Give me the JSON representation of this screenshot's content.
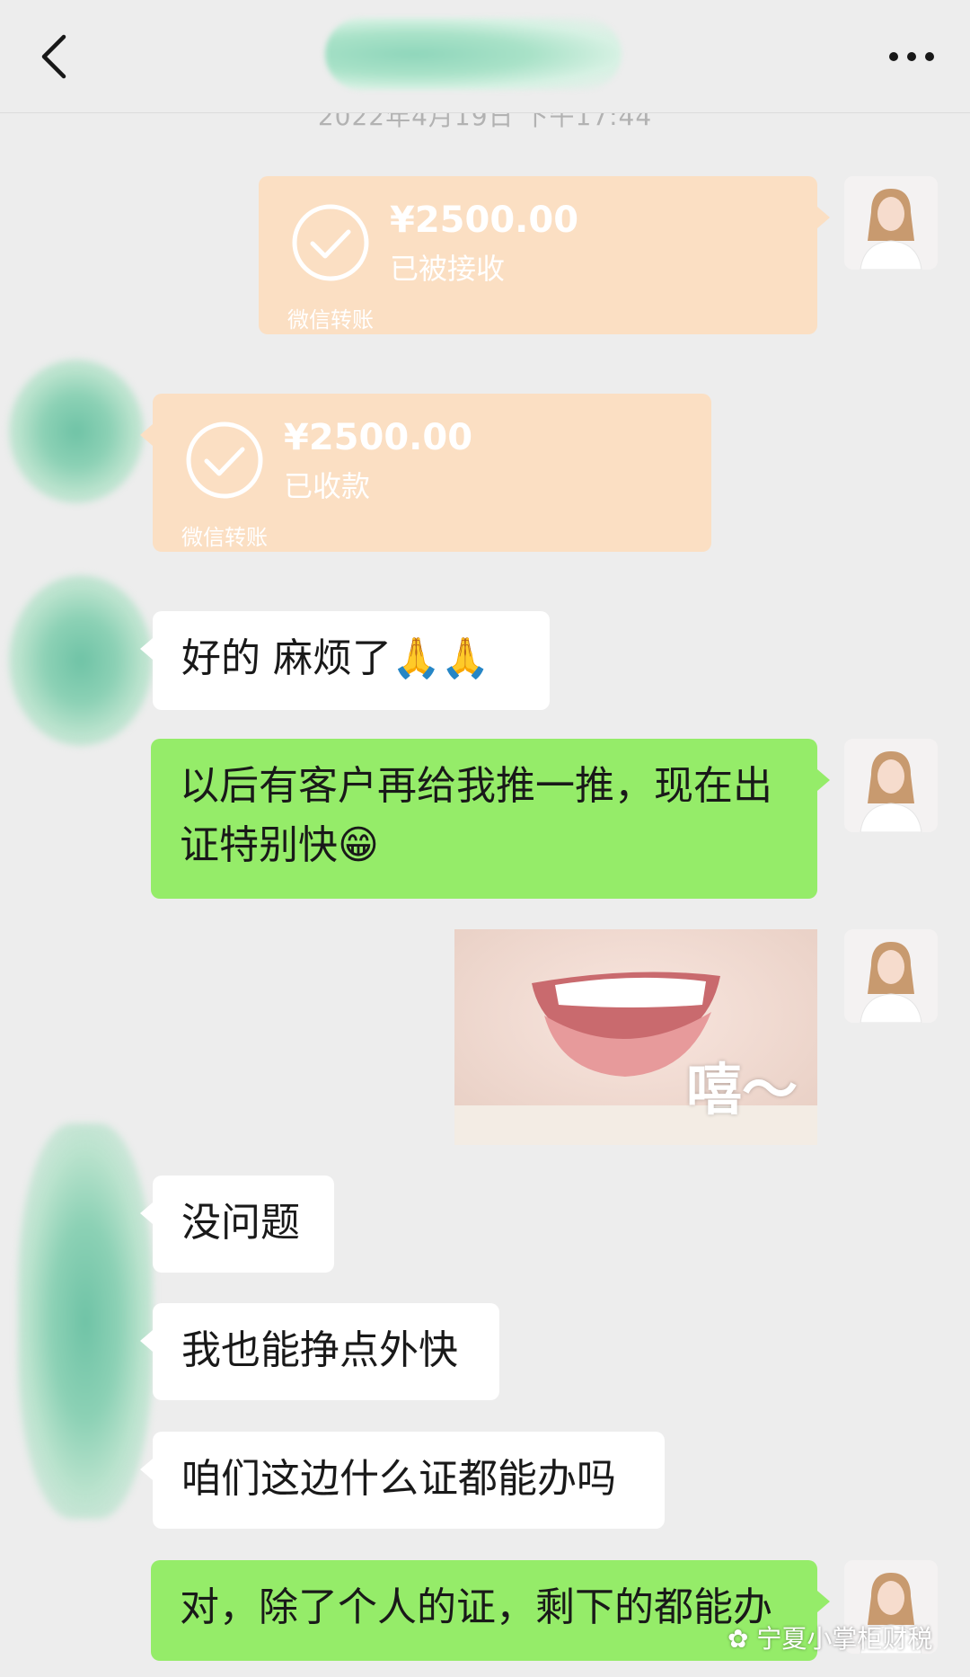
{
  "header": {
    "back_icon": "chevron-left-icon",
    "more_icon": "more-horizontal-icon"
  },
  "timestamp": "2022年4月19日 下午17:44",
  "transfers": [
    {
      "amount": "¥2500.00",
      "status": "已被接收",
      "source": "微信转账",
      "side": "right"
    },
    {
      "amount": "¥2500.00",
      "status": "已收款",
      "source": "微信转账",
      "side": "left"
    }
  ],
  "messages": [
    {
      "side": "left",
      "text": "好的  麻烦了🙏🙏"
    },
    {
      "side": "right",
      "text": "以后有客户再给我推一推，现在出证特别快😁"
    },
    {
      "side": "right",
      "type": "image",
      "caption": "嘻～"
    },
    {
      "side": "left",
      "text": "没问题"
    },
    {
      "side": "left",
      "text": "我也能挣点外快"
    },
    {
      "side": "left",
      "text": "咱们这边什么证都能办吗"
    },
    {
      "side": "right",
      "text": "对，除了个人的证，剩下的都能办"
    }
  ],
  "watermark": "宁夏小掌柜财税",
  "colors": {
    "background": "#ededed",
    "green_bubble": "#95ec69",
    "white_bubble": "#ffffff",
    "transfer_card": "#fbdfc3"
  }
}
